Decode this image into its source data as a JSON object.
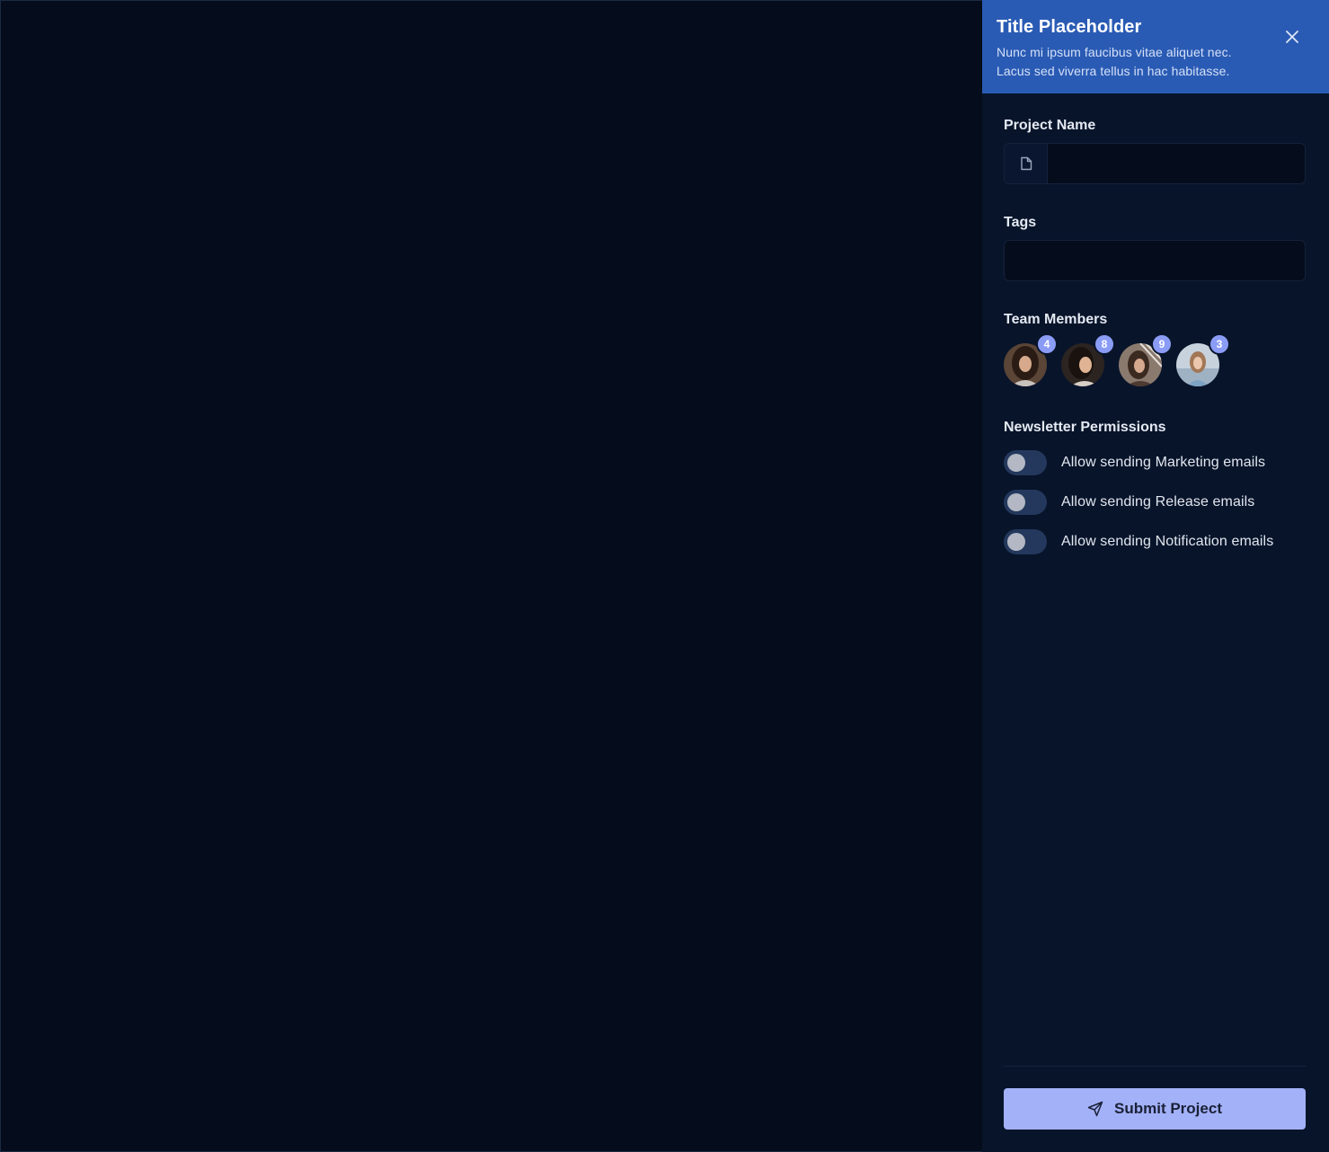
{
  "drawer": {
    "title": "Title Placeholder",
    "description": "Nunc mi ipsum faucibus vitae aliquet nec. Lacus sed viverra tellus in hac habitasse.",
    "close_icon": "close-icon"
  },
  "form": {
    "project_name": {
      "label": "Project Name",
      "value": "",
      "icon": "document-icon"
    },
    "tags": {
      "label": "Tags",
      "value": ""
    },
    "team_members": {
      "label": "Team Members",
      "members": [
        {
          "badge": "4"
        },
        {
          "badge": "8"
        },
        {
          "badge": "9"
        },
        {
          "badge": "3"
        }
      ]
    },
    "newsletter": {
      "label": "Newsletter Permissions",
      "options": [
        {
          "label": "Allow sending Marketing emails",
          "enabled": false
        },
        {
          "label": "Allow sending Release emails",
          "enabled": false
        },
        {
          "label": "Allow sending Notification emails",
          "enabled": false
        }
      ]
    }
  },
  "footer": {
    "submit_label": "Submit Project",
    "submit_icon": "send-icon"
  },
  "colors": {
    "header_bg": "#2a5bb4",
    "panel_bg": "#08142a",
    "backdrop_bg": "#050c1b",
    "badge": "#8b9cf6",
    "submit_bg": "#a3b1f8",
    "toggle_track": "#23385c"
  }
}
